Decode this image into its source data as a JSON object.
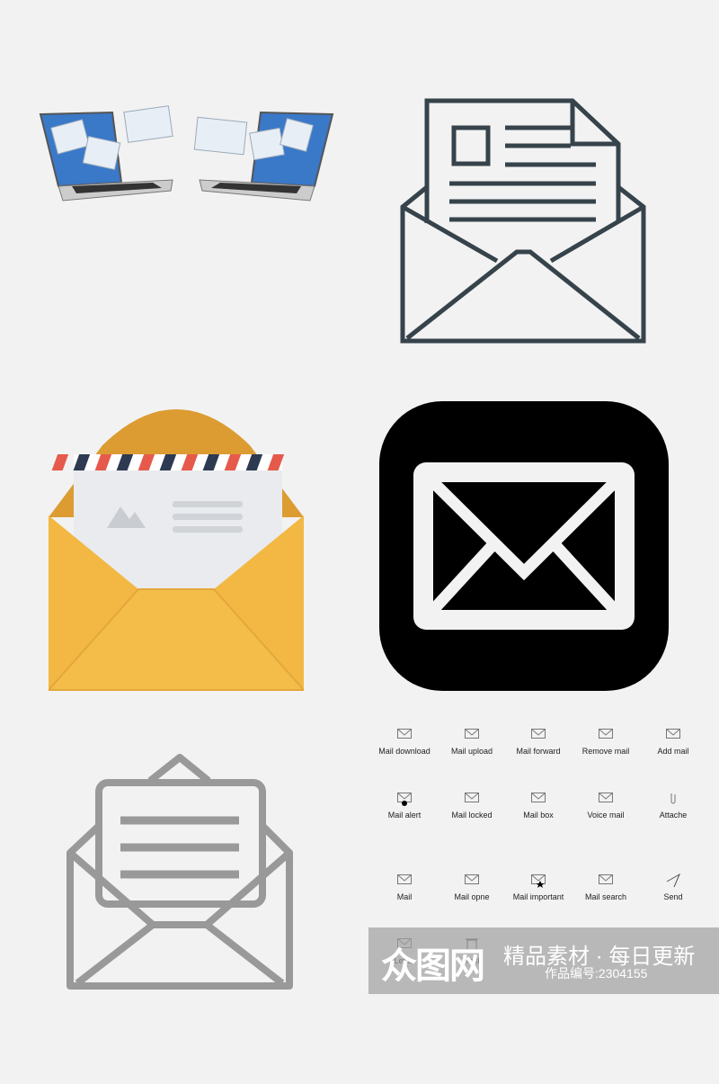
{
  "colors": {
    "background": "#f2f2f2",
    "dark_outline": "#36434b",
    "gold": "#f2b843",
    "gold_dark": "#dc9c32",
    "black_tile": "#000000",
    "gray_outline": "#999999",
    "airmail_red": "#e65a4b",
    "airmail_navy": "#2e3a52"
  },
  "illustrations": [
    {
      "name": "laptops-exchanging-mail"
    },
    {
      "name": "open-envelope-with-letter-outline"
    },
    {
      "name": "yellow-airmail-envelope"
    },
    {
      "name": "black-mail-app-tile"
    },
    {
      "name": "gray-open-envelope-outline"
    }
  ],
  "icon_grid": [
    {
      "label": "Mail download",
      "icon": "mail-download-icon"
    },
    {
      "label": "Mail upload",
      "icon": "mail-upload-icon"
    },
    {
      "label": "Mail forward",
      "icon": "mail-forward-icon"
    },
    {
      "label": "Remove mail",
      "icon": "remove-mail-icon"
    },
    {
      "label": "Add mail",
      "icon": "add-mail-icon"
    },
    {
      "label": "Mail alert",
      "icon": "mail-alert-icon"
    },
    {
      "label": "Mail locked",
      "icon": "mail-locked-icon"
    },
    {
      "label": "Mail box",
      "icon": "mailbox-icon"
    },
    {
      "label": "Voice mail",
      "icon": "voice-mail-icon"
    },
    {
      "label": "Attache",
      "icon": "paperclip-icon"
    },
    {
      "label": "Mail",
      "icon": "mail-icon"
    },
    {
      "label": "Mail opne",
      "icon": "mail-open-icon"
    },
    {
      "label": "Mail important",
      "icon": "mail-important-icon"
    },
    {
      "label": "Mail search",
      "icon": "mail-search-icon"
    },
    {
      "label": "Send",
      "icon": "send-icon"
    },
    {
      "label": "Letter",
      "icon": "letter-icon"
    },
    {
      "label": "Trash",
      "icon": "trash-icon"
    }
  ],
  "watermark": {
    "logo": "众图网",
    "slogan": "精品素材 · 每日更新",
    "code": "作品编号:2304155"
  }
}
